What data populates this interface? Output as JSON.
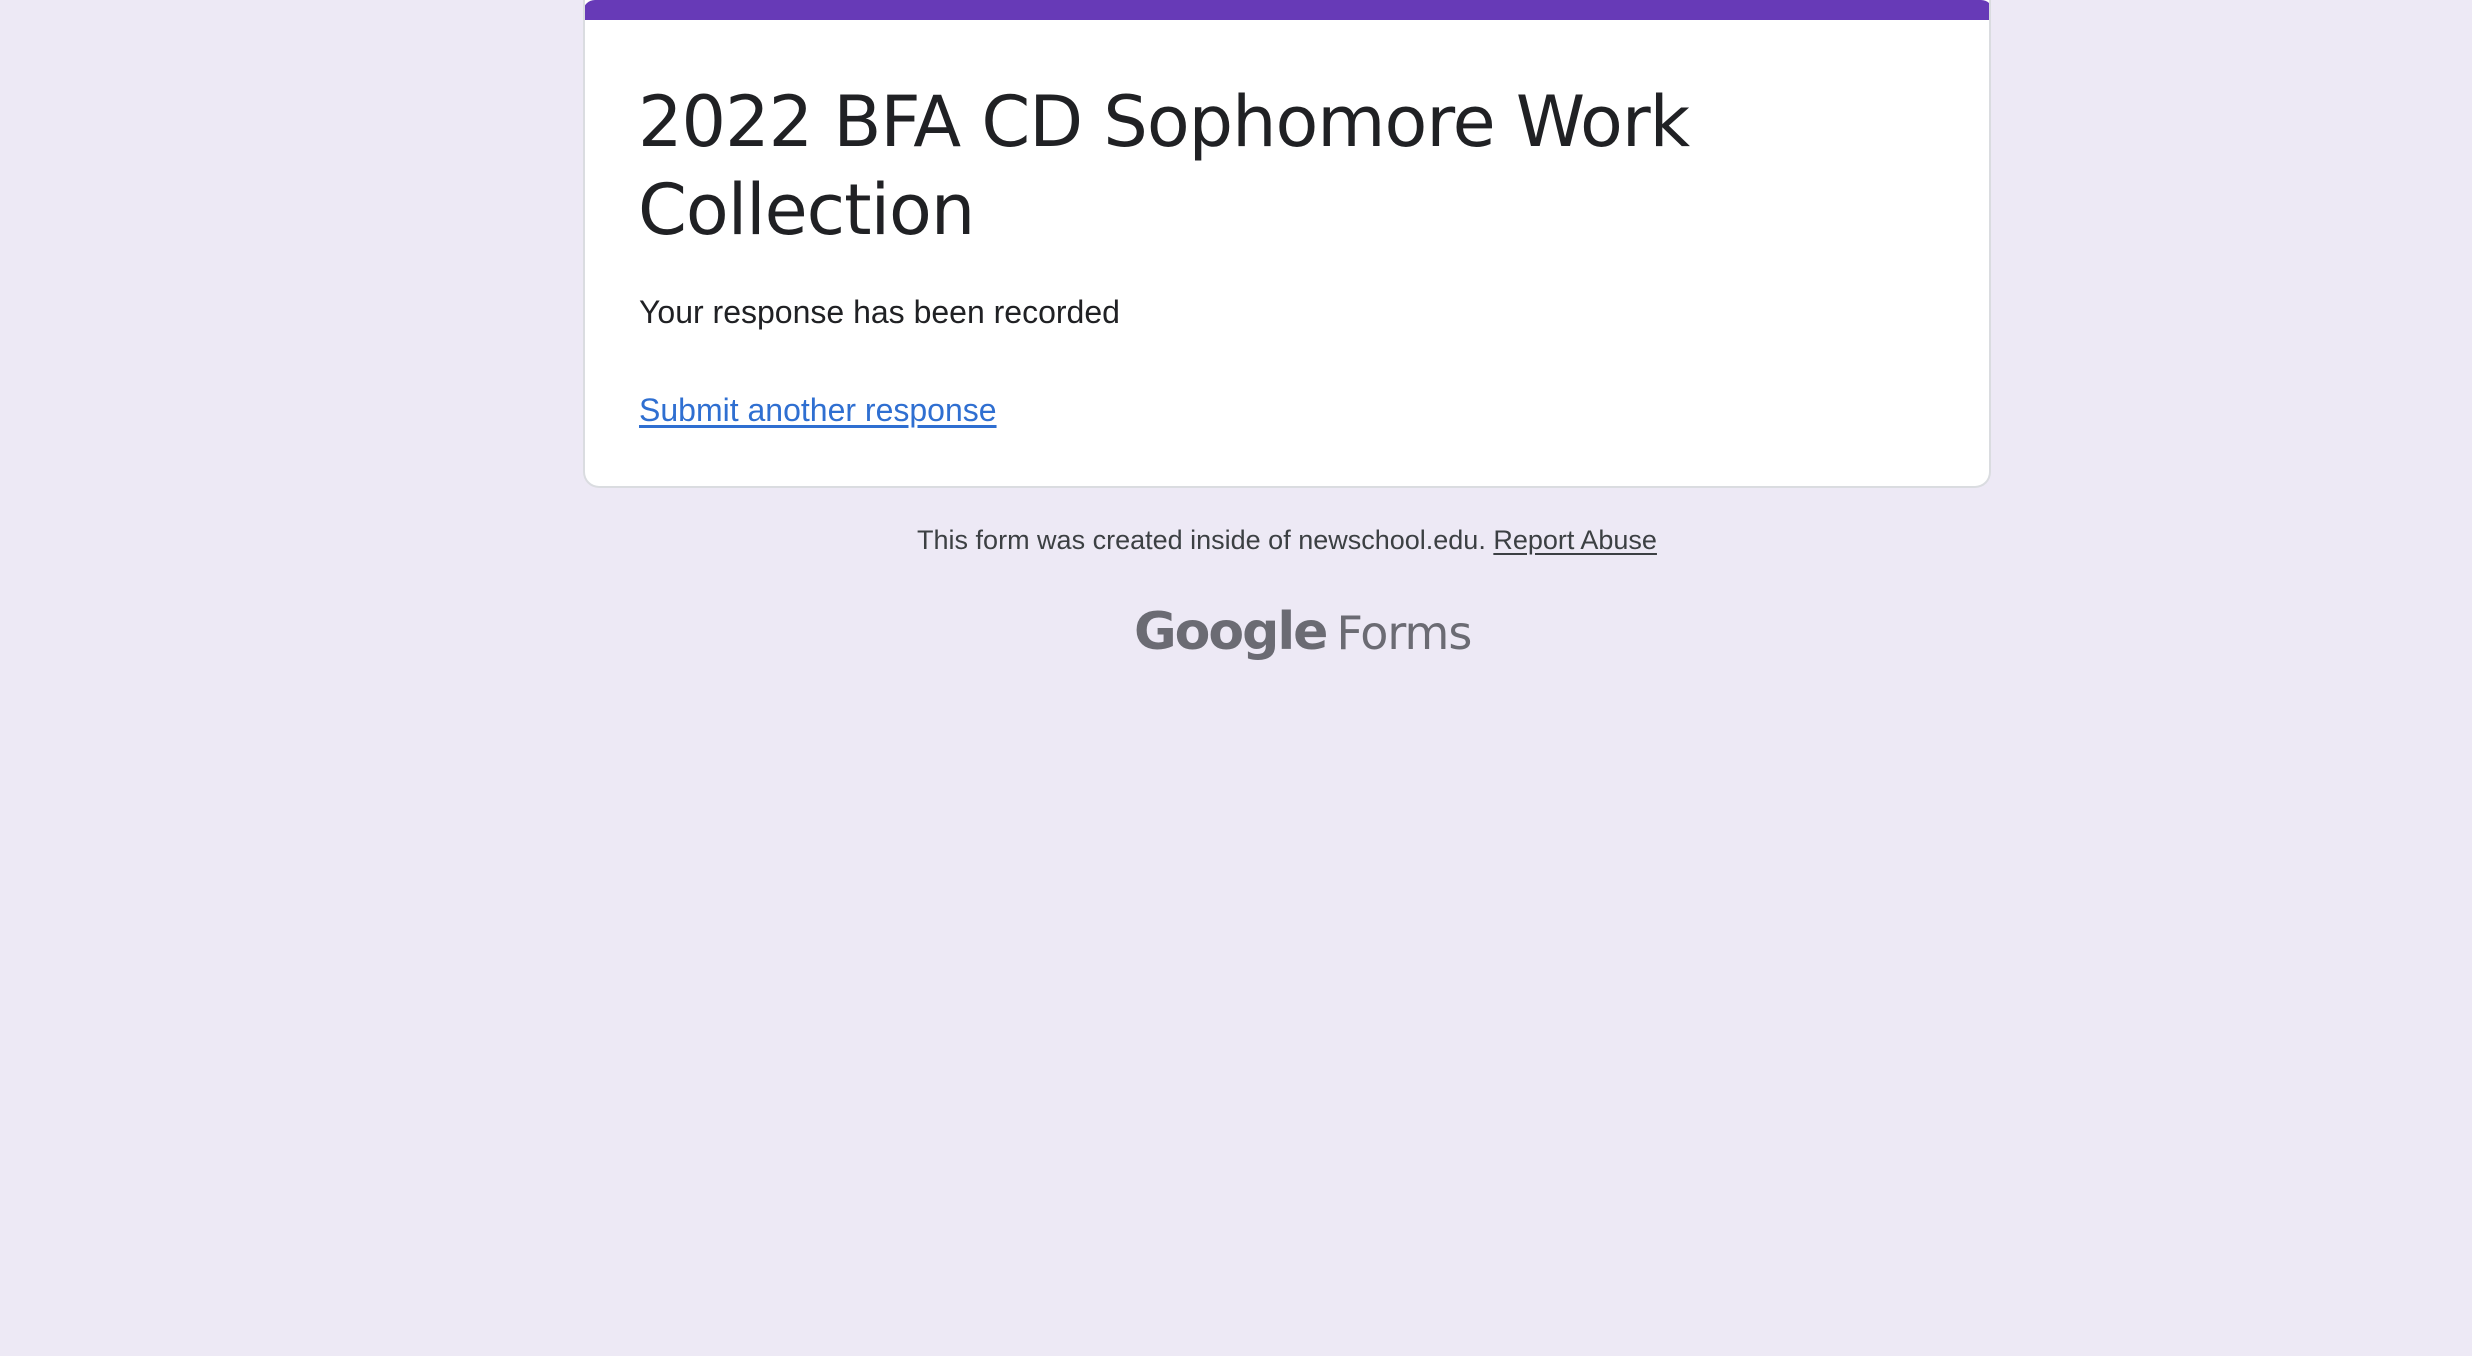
{
  "form": {
    "title": "2022 BFA CD Sophomore Work Collection",
    "confirmation_message": "Your response has been recorded",
    "submit_another_label": "Submit another response",
    "accent_color": "#673ab7"
  },
  "footer": {
    "note": "This form was created inside of newschool.edu.",
    "report_abuse_label": "Report Abuse",
    "brand_google": "Google",
    "brand_forms": "Forms"
  },
  "colors": {
    "background": "#ede9f5",
    "link": "#2f6fd1",
    "text": "#202124"
  }
}
